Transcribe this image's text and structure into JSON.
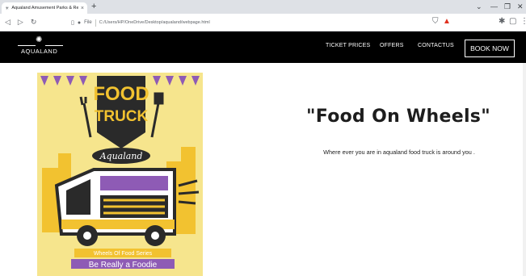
{
  "browser": {
    "tab_title": "Aqualand Amusement Parks & Re",
    "tab_close": "×",
    "new_tab": "+",
    "omnibox_label": "File",
    "url": "C:/Users/HP/OneDrive/Desktop/aqualand/webpage.html",
    "window_controls": [
      "⌄",
      "—",
      "❐",
      "✕"
    ]
  },
  "navbar": {
    "logo_text": "AQUALAND",
    "links": [
      "TICKET PRICES",
      "OFFERS",
      "CONTACTUS"
    ],
    "cta_label": "BOOK NOW"
  },
  "poster": {
    "title_line1": "FOOD",
    "title_line2": "TRUCK",
    "script_brand": "Aqualand",
    "ribbon_text": "Wheels Of Food Series",
    "banner_text": "Be Really a Foodie"
  },
  "main": {
    "heading": "\"Food On Wheels\"",
    "tagline": "Where ever you are in aqualand food truck is around you ."
  },
  "colors": {
    "navbar_bg": "#000000",
    "poster_bg": "#f6e58d",
    "poster_dark": "#2a2a2a",
    "poster_purple": "#8e5bb5",
    "poster_yellow": "#f2c230"
  }
}
